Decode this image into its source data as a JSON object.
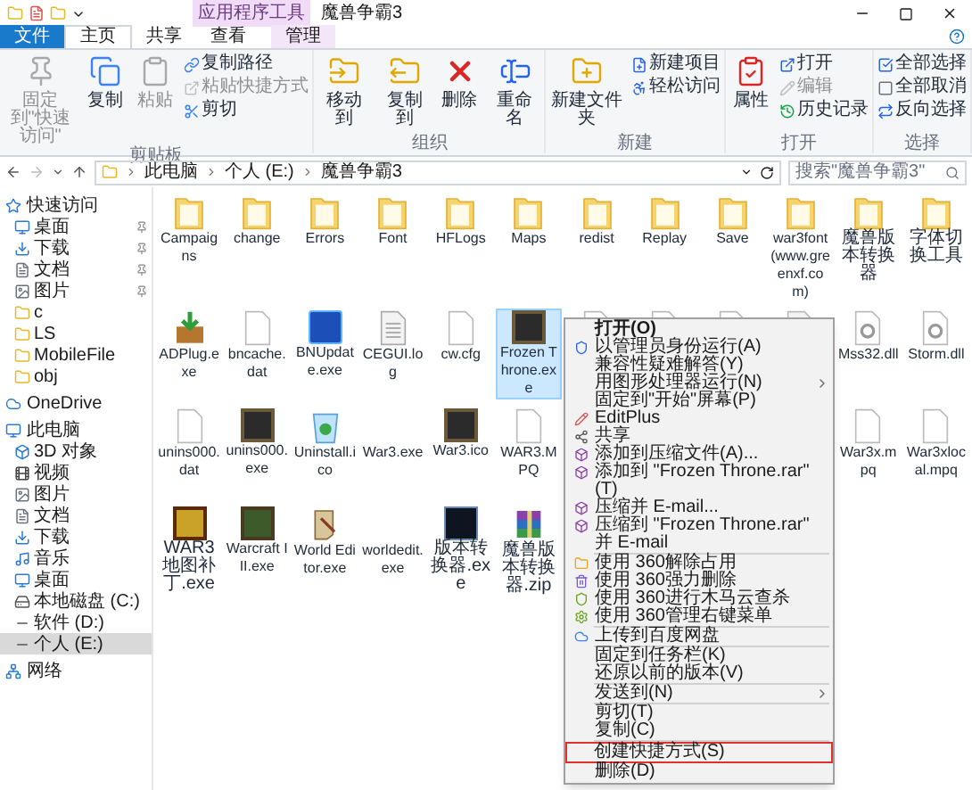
{
  "window": {
    "title": "魔兽争霸3",
    "context_tab": "应用程序工具"
  },
  "tabs": [
    {
      "label": "文件",
      "kind": "file",
      "selected": false
    },
    {
      "label": "主页",
      "kind": "tab",
      "selected": true
    },
    {
      "label": "共享",
      "kind": "tab",
      "selected": false
    },
    {
      "label": "查看",
      "kind": "tab",
      "selected": false
    },
    {
      "label": "管理",
      "kind": "context",
      "selected": false
    }
  ],
  "ribbon": [
    {
      "label": "剪贴板",
      "items": [
        {
          "label": "固定到\"快速访问\"",
          "kind": "large",
          "disabled": true
        },
        {
          "label": "复制",
          "kind": "large",
          "disabled": false
        },
        {
          "label": "粘贴",
          "kind": "large",
          "disabled": true
        },
        {
          "label": "复制路径",
          "kind": "small",
          "disabled": false
        },
        {
          "label": "粘贴快捷方式",
          "kind": "small",
          "disabled": true
        },
        {
          "label": "剪切",
          "kind": "small",
          "disabled": false
        }
      ]
    },
    {
      "label": "组织",
      "items": [
        {
          "label": "移动到",
          "kind": "large",
          "disabled": false
        },
        {
          "label": "复制到",
          "kind": "large",
          "disabled": false
        },
        {
          "label": "删除",
          "kind": "large",
          "disabled": false
        },
        {
          "label": "重命名",
          "kind": "large",
          "disabled": false
        }
      ]
    },
    {
      "label": "新建",
      "items": [
        {
          "label": "新建文件夹",
          "kind": "large",
          "disabled": false
        },
        {
          "label": "新建项目",
          "kind": "small",
          "disabled": false
        },
        {
          "label": "轻松访问",
          "kind": "small",
          "disabled": false
        }
      ]
    },
    {
      "label": "打开",
      "items": [
        {
          "label": "属性",
          "kind": "large",
          "disabled": false
        },
        {
          "label": "打开",
          "kind": "small",
          "disabled": false
        },
        {
          "label": "编辑",
          "kind": "small",
          "disabled": true
        },
        {
          "label": "历史记录",
          "kind": "small",
          "disabled": false
        }
      ]
    },
    {
      "label": "选择",
      "items": [
        {
          "label": "全部选择",
          "kind": "small",
          "disabled": false
        },
        {
          "label": "全部取消",
          "kind": "small",
          "disabled": false
        },
        {
          "label": "反向选择",
          "kind": "small",
          "disabled": false
        }
      ]
    }
  ],
  "address": {
    "path": [
      "此电脑",
      "个人 (E:)",
      "魔兽争霸3"
    ],
    "search_placeholder": "搜索\"魔兽争霸3\""
  },
  "sidebar": [
    {
      "label": "快速访问",
      "selected": false,
      "children": [
        {
          "label": "桌面",
          "pinned": true,
          "selected": false
        },
        {
          "label": "下载",
          "pinned": true,
          "selected": false
        },
        {
          "label": "文档",
          "pinned": true,
          "selected": false
        },
        {
          "label": "图片",
          "pinned": true,
          "selected": false
        },
        {
          "label": "c",
          "pinned": false,
          "selected": false
        },
        {
          "label": "LS",
          "pinned": false,
          "selected": false
        },
        {
          "label": "MobileFile",
          "pinned": false,
          "selected": false
        },
        {
          "label": "obj",
          "pinned": false,
          "selected": false
        }
      ]
    },
    {
      "label": "OneDrive",
      "selected": false
    },
    {
      "label": "此电脑",
      "selected": false,
      "children": [
        {
          "label": "3D 对象",
          "pinned": false,
          "selected": false
        },
        {
          "label": "视频",
          "pinned": false,
          "selected": false
        },
        {
          "label": "图片",
          "pinned": false,
          "selected": false
        },
        {
          "label": "文档",
          "pinned": false,
          "selected": false
        },
        {
          "label": "下载",
          "pinned": false,
          "selected": false
        },
        {
          "label": "音乐",
          "pinned": false,
          "selected": false
        },
        {
          "label": "桌面",
          "pinned": false,
          "selected": false
        },
        {
          "label": "本地磁盘 (C:)",
          "pinned": false,
          "selected": false
        },
        {
          "label": "软件 (D:)",
          "pinned": false,
          "selected": false
        },
        {
          "label": "个人 (E:)",
          "pinned": false,
          "selected": true
        }
      ]
    },
    {
      "label": "网络",
      "selected": false
    }
  ],
  "files": [
    {
      "name": "Campaigns",
      "kind": "folder",
      "selected": false
    },
    {
      "name": "change",
      "kind": "folder",
      "selected": false
    },
    {
      "name": "Errors",
      "kind": "folder",
      "selected": false
    },
    {
      "name": "Font",
      "kind": "folder",
      "selected": false
    },
    {
      "name": "HFLogs",
      "kind": "folder",
      "selected": false
    },
    {
      "name": "Maps",
      "kind": "folder",
      "selected": false
    },
    {
      "name": "redist",
      "kind": "folder",
      "selected": false
    },
    {
      "name": "Replay",
      "kind": "folder",
      "selected": false
    },
    {
      "name": "Save",
      "kind": "folder",
      "selected": false
    },
    {
      "name": "war3font(www.greenxf.com)",
      "kind": "folder",
      "selected": false
    },
    {
      "name": "魔兽版本转换器",
      "kind": "folder",
      "selected": false
    },
    {
      "name": "字体切换工具",
      "kind": "folder",
      "selected": false
    },
    {
      "name": "ADPlug.exe",
      "kind": "installer",
      "selected": false
    },
    {
      "name": "bncache.dat",
      "kind": "file",
      "selected": false
    },
    {
      "name": "BNUpdate.exe",
      "kind": "app",
      "selected": false
    },
    {
      "name": "CEGUI.log",
      "kind": "text",
      "selected": false
    },
    {
      "name": "cw.cfg",
      "kind": "file",
      "selected": false
    },
    {
      "name": "Frozen Throne.exe",
      "kind": "game",
      "selected": true
    },
    {
      "kind": "config"
    },
    {
      "kind": "file"
    },
    {
      "kind": "config"
    },
    {
      "kind": "text"
    },
    {
      "name": "Mss32.dll",
      "kind": "config",
      "selected": false
    },
    {
      "name": "Storm.dll",
      "kind": "config",
      "selected": false
    },
    {
      "name": "unins000.dat",
      "kind": "file",
      "selected": false
    },
    {
      "name": "unins000.exe",
      "kind": "game",
      "selected": false
    },
    {
      "name": "Uninstall.ico",
      "kind": "recycle",
      "selected": false
    },
    {
      "name": "War3.exe",
      "kind": "blank",
      "selected": false
    },
    {
      "name": "War3.ico",
      "kind": "game",
      "selected": false
    },
    {
      "name": "WAR3.MPQ",
      "kind": "file",
      "selected": false
    },
    {
      "kind": "covered"
    },
    {
      "kind": "covered"
    },
    {
      "kind": "covered"
    },
    {
      "kind": "covered"
    },
    {
      "name": "War3x.mpq",
      "kind": "file",
      "selected": false
    },
    {
      "name": "War3xlocal.mpq",
      "kind": "file",
      "selected": false
    },
    {
      "name": "WAR3地图补丁.exe",
      "kind": "logo",
      "selected": false
    },
    {
      "name": "Warcraft III.exe",
      "kind": "orc",
      "selected": false
    },
    {
      "name": "World Editor.exe",
      "kind": "scroll",
      "selected": false
    },
    {
      "name": "worldedit.exe",
      "kind": "blank",
      "selected": false
    },
    {
      "name": "版本转换器.exe",
      "kind": "tree",
      "selected": false
    },
    {
      "name": "魔兽版本转换器.zip",
      "kind": "archive",
      "selected": false
    }
  ],
  "context_menu": [
    {
      "kind": "item",
      "label": "打开(O)",
      "default": true,
      "submenu": false,
      "highlighted": false
    },
    {
      "kind": "item",
      "label": "以管理员身份运行(A)",
      "default": false,
      "submenu": false,
      "highlighted": false
    },
    {
      "kind": "item",
      "label": "兼容性疑难解答(Y)",
      "default": false,
      "submenu": false,
      "highlighted": false
    },
    {
      "kind": "item",
      "label": "用图形处理器运行(N)",
      "default": false,
      "submenu": true,
      "highlighted": false
    },
    {
      "kind": "item",
      "label": "固定到\"开始\"屏幕(P)",
      "default": false,
      "submenu": false,
      "highlighted": false
    },
    {
      "kind": "item",
      "label": "EditPlus",
      "default": false,
      "submenu": false,
      "highlighted": false
    },
    {
      "kind": "item",
      "label": "共享",
      "default": false,
      "submenu": false,
      "highlighted": false
    },
    {
      "kind": "item",
      "label": "添加到压缩文件(A)...",
      "default": false,
      "submenu": false,
      "highlighted": false
    },
    {
      "kind": "item",
      "label": "添加到 \"Frozen Throne.rar\"(T)",
      "default": false,
      "submenu": false,
      "highlighted": false
    },
    {
      "kind": "item",
      "label": "压缩并 E-mail...",
      "default": false,
      "submenu": false,
      "highlighted": false
    },
    {
      "kind": "item",
      "label": "压缩到 \"Frozen Throne.rar\" 并 E-mail",
      "default": false,
      "submenu": false,
      "highlighted": false
    },
    {
      "kind": "separator"
    },
    {
      "kind": "item",
      "label": "使用 360解除占用",
      "default": false,
      "submenu": false,
      "highlighted": false
    },
    {
      "kind": "item",
      "label": "使用 360强力删除",
      "default": false,
      "submenu": false,
      "highlighted": false
    },
    {
      "kind": "item",
      "label": "使用 360进行木马云查杀",
      "default": false,
      "submenu": false,
      "highlighted": false
    },
    {
      "kind": "item",
      "label": "使用 360管理右键菜单",
      "default": false,
      "submenu": false,
      "highlighted": false
    },
    {
      "kind": "separator"
    },
    {
      "kind": "item",
      "label": "上传到百度网盘",
      "default": false,
      "submenu": false,
      "highlighted": false
    },
    {
      "kind": "separator"
    },
    {
      "kind": "item",
      "label": "固定到任务栏(K)",
      "default": false,
      "submenu": false,
      "highlighted": false
    },
    {
      "kind": "item",
      "label": "还原以前的版本(V)",
      "default": false,
      "submenu": false,
      "highlighted": false
    },
    {
      "kind": "separator"
    },
    {
      "kind": "item",
      "label": "发送到(N)",
      "default": false,
      "submenu": true,
      "highlighted": false
    },
    {
      "kind": "separator"
    },
    {
      "kind": "item",
      "label": "剪切(T)",
      "default": false,
      "submenu": false,
      "highlighted": false
    },
    {
      "kind": "item",
      "label": "复制(C)",
      "default": false,
      "submenu": false,
      "highlighted": false
    },
    {
      "kind": "separator"
    },
    {
      "kind": "item",
      "label": "创建快捷方式(S)",
      "default": false,
      "submenu": false,
      "highlighted": true
    },
    {
      "kind": "item",
      "label": "删除(D)",
      "default": false,
      "submenu": false,
      "highlighted": false
    }
  ]
}
